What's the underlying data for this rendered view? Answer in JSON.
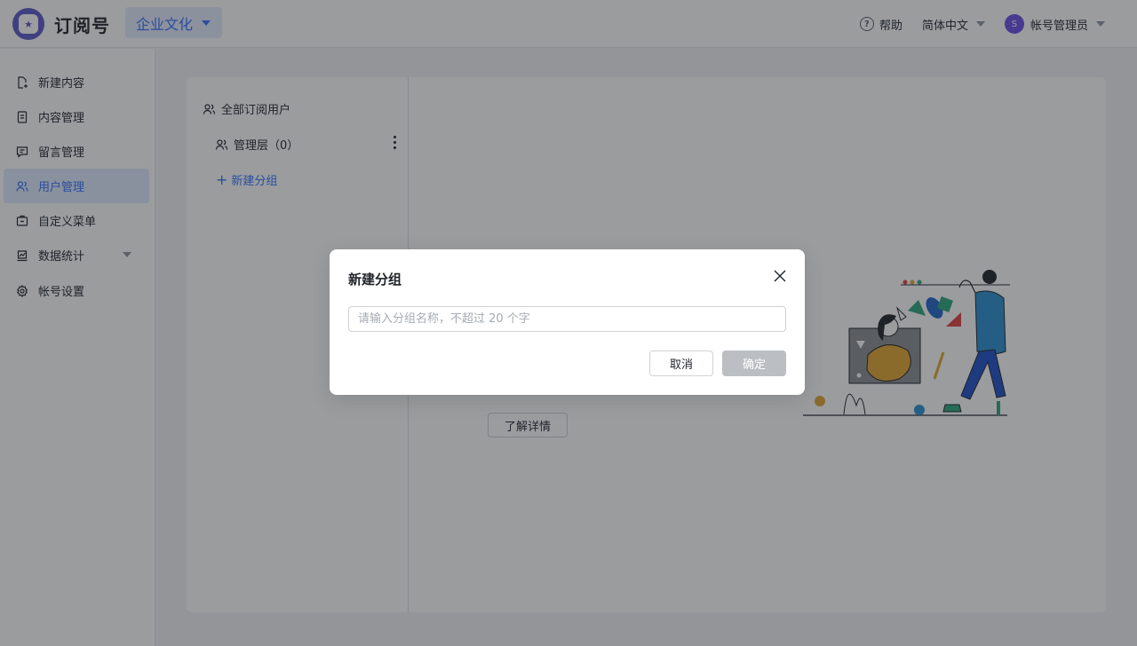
{
  "header": {
    "app_title": "订阅号",
    "account_name": "企业文化",
    "help_label": "帮助",
    "language": "简体中文",
    "user_avatar_letter": "S",
    "user_name": "帐号管理员"
  },
  "sidebar": {
    "items": [
      {
        "label": "新建内容",
        "icon": "new-content-icon",
        "active": false
      },
      {
        "label": "内容管理",
        "icon": "document-icon",
        "active": false
      },
      {
        "label": "留言管理",
        "icon": "comment-icon",
        "active": false
      },
      {
        "label": "用户管理",
        "icon": "users-icon",
        "active": true
      },
      {
        "label": "自定义菜单",
        "icon": "menu-icon",
        "active": false
      },
      {
        "label": "数据统计",
        "icon": "stats-icon",
        "active": false,
        "expandable": true
      },
      {
        "label": "帐号设置",
        "icon": "gear-icon",
        "active": false
      }
    ]
  },
  "groups": {
    "all_label": "全部订阅用户",
    "items": [
      {
        "label": "管理层（0）"
      }
    ],
    "new_group_label": "新建分组"
  },
  "main": {
    "detail_button": "了解详情"
  },
  "modal": {
    "title": "新建分组",
    "input_value": "",
    "input_placeholder": "请输入分组名称，不超过 20 个字",
    "cancel_label": "取消",
    "confirm_label": "确定"
  },
  "colors": {
    "accent": "#3370ff",
    "brand": "#5b56c9",
    "avatar": "#6b4de6",
    "disabled_button": "#bbbfc4"
  }
}
